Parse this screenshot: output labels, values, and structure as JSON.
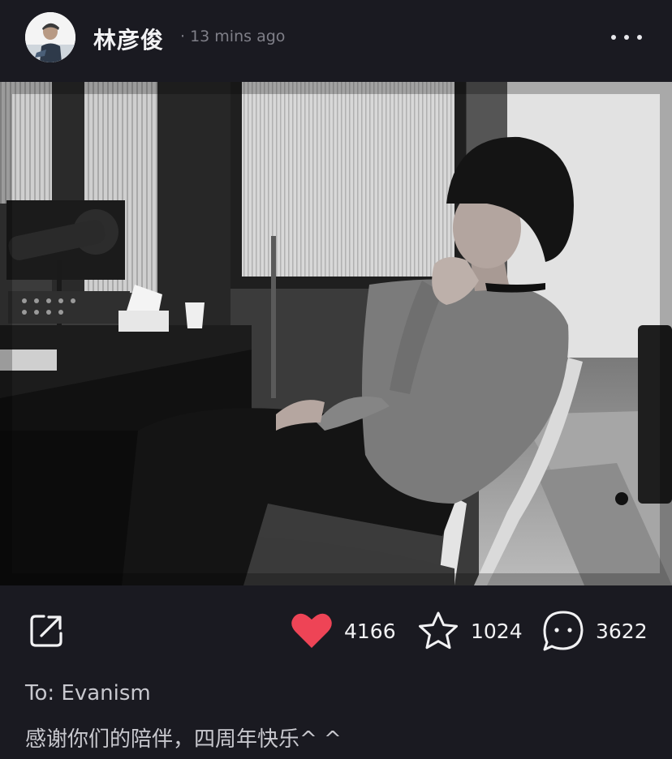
{
  "post": {
    "author": {
      "name": "林彦俊",
      "avatar_icon": "user-avatar-photo"
    },
    "time": "· 13 mins ago",
    "more_icon": "more-dots-icon"
  },
  "actions": {
    "share_icon": "share-icon",
    "like": {
      "icon": "heart-icon",
      "count": "4166",
      "color": "#ee4456"
    },
    "favorite": {
      "icon": "star-icon",
      "count": "1024"
    },
    "comment": {
      "icon": "comment-icon",
      "count": "3622"
    }
  },
  "caption": {
    "recipient": "To: Evanism",
    "text": "感谢你们的陪伴，四周年快乐^ ^"
  },
  "colors": {
    "background": "#1a1a21",
    "text_primary": "#f2f2f4",
    "text_secondary": "#7f7f88",
    "like": "#ee4456"
  }
}
